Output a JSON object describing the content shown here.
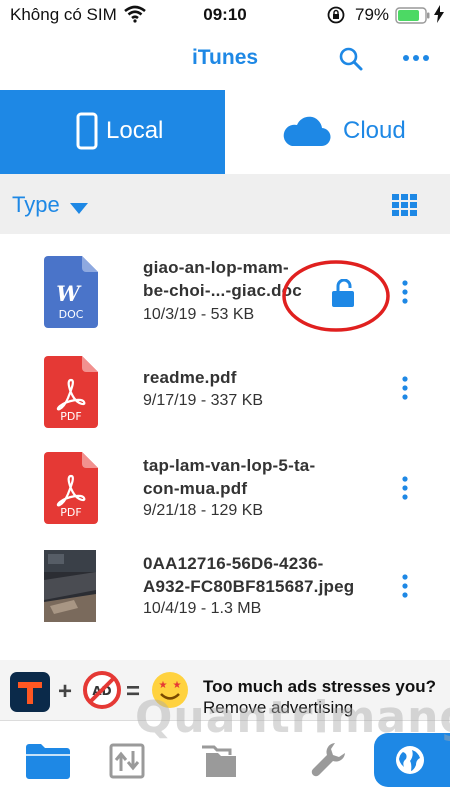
{
  "status_bar": {
    "carrier": "Không có SIM",
    "time": "09:10",
    "battery": "79%"
  },
  "nav": {
    "title": "iTunes"
  },
  "segments": {
    "local": "Local",
    "cloud": "Cloud"
  },
  "filter": {
    "type_label": "Type"
  },
  "files": [
    {
      "name_line1": "giao-an-lop-mam-",
      "name_line2": "be-choi-...-giac.doc",
      "meta": "10/3/19 - 53 KB",
      "badge": "DOC",
      "locked": true
    },
    {
      "name_line1": "readme.pdf",
      "name_line2": "",
      "meta": "9/17/19 - 337 KB",
      "badge": "PDF"
    },
    {
      "name_line1": "tap-lam-van-lop-5-ta-",
      "name_line2": "con-mua.pdf",
      "meta": "9/21/18 - 129 KB",
      "badge": "PDF"
    },
    {
      "name_line1": "0AA12716-56D6-4236-",
      "name_line2": "A932-FC80BF815687.jpeg",
      "meta": "10/4/19 - 1.3 MB",
      "badge": ""
    }
  ],
  "ad": {
    "line1": "Too much ads stresses you?",
    "line2": "Remove advertising",
    "badge": "AD"
  },
  "watermark": "Quantrimang",
  "colors": {
    "accent": "#1e88e5",
    "pdf_red": "#e53935",
    "doc_blue": "#4a74c9",
    "highlight_circle": "#e0201f"
  }
}
